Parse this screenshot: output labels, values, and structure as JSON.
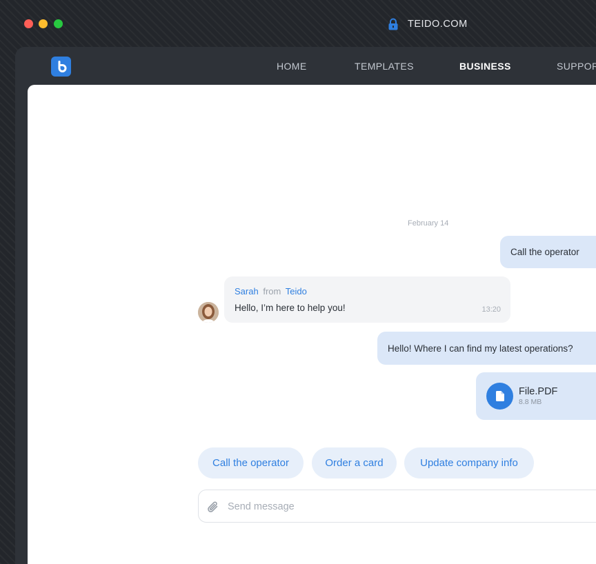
{
  "window": {
    "url": "TEIDO.COM"
  },
  "nav": {
    "items": [
      {
        "label": "HOME"
      },
      {
        "label": "TEMPLATES"
      },
      {
        "label": "BUSINESS"
      },
      {
        "label": "SUPPOR"
      }
    ],
    "active": "BUSINESS"
  },
  "chat": {
    "date": "February 14",
    "messages": [
      {
        "type": "outgoing",
        "text": "Call the operator"
      },
      {
        "type": "incoming",
        "sender_name": "Sarah",
        "sender_from": "from",
        "sender_company": "Teido",
        "text": "Hello, I’m here to help you!",
        "time": "13:20"
      },
      {
        "type": "outgoing",
        "text": "Hello! Where I can find my latest operations?"
      },
      {
        "type": "outgoing-file",
        "file_name": "File.PDF",
        "file_size": "8.8 MB"
      }
    ],
    "quick_replies": [
      {
        "label": "Call the operator"
      },
      {
        "label": "Order a card"
      },
      {
        "label": "Update company info"
      }
    ],
    "composer": {
      "placeholder": "Send message",
      "value": ""
    }
  },
  "colors": {
    "accent": "#2f7fe0",
    "outgoing_bubble": "#dbe7f8",
    "incoming_bubble": "#f3f4f6",
    "chip_bg": "#e7effa",
    "frame_bg": "#2e3238"
  },
  "icons": {
    "lock": "lock-icon",
    "logo": "teido-logo-icon",
    "file": "document-icon",
    "attach": "paperclip-icon"
  }
}
